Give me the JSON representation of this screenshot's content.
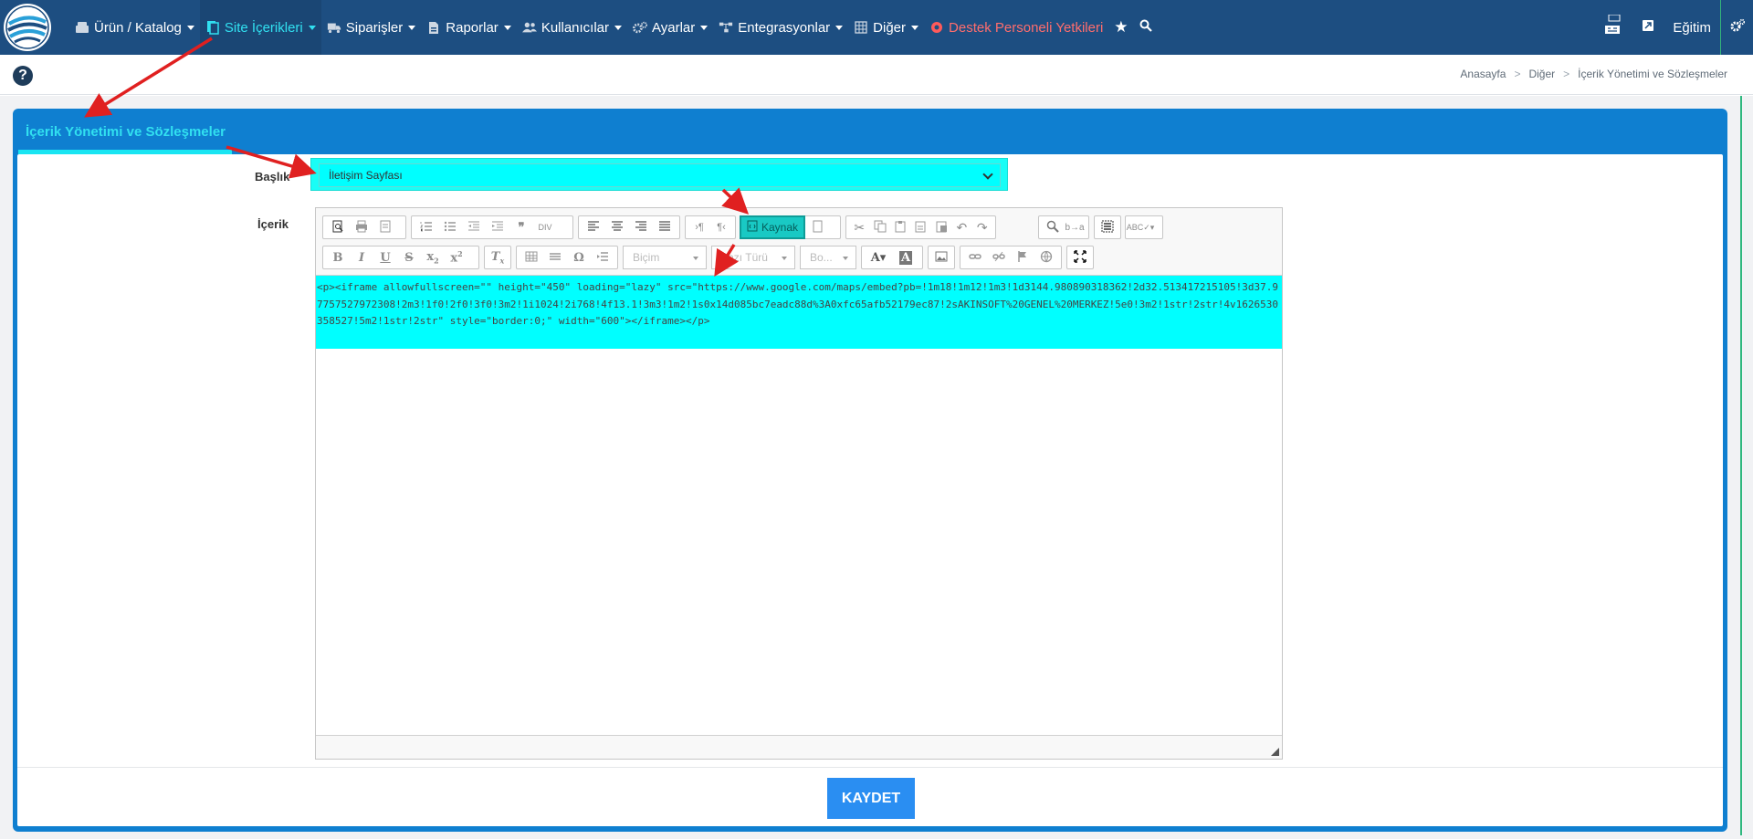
{
  "nav": {
    "items": [
      {
        "label": "Ürün / Katalog",
        "icon": "catalog-icon",
        "active": false
      },
      {
        "label": "Site İçerikleri",
        "icon": "content-icon",
        "active": true
      },
      {
        "label": "Siparişler",
        "icon": "truck-icon",
        "active": false
      },
      {
        "label": "Raporlar",
        "icon": "report-icon",
        "active": false
      },
      {
        "label": "Kullanıcılar",
        "icon": "users-icon",
        "active": false
      },
      {
        "label": "Ayarlar",
        "icon": "gears-icon",
        "active": false
      },
      {
        "label": "Entegrasyonlar",
        "icon": "sitemap-icon",
        "active": false
      },
      {
        "label": "Diğer",
        "icon": "grid-icon",
        "active": false
      }
    ],
    "support_label": "Destek Personeli Yetkileri",
    "training_label": "Eğitim"
  },
  "breadcrumb": [
    "Anasayfa",
    "Diğer",
    "İçerik Yönetimi ve Sözleşmeler"
  ],
  "panel": {
    "title": "İçerik Yönetimi ve Sözleşmeler"
  },
  "form": {
    "title_label": "Başlık",
    "title_value": "İletişim Sayfası",
    "content_label": "İçerik"
  },
  "editor": {
    "source_label": "Kaynak",
    "format_placeholder": "Biçim",
    "font_placeholder": "Yazı Türü",
    "size_placeholder": "Bo...",
    "source_code": "<p><iframe allowfullscreen=\"\" height=\"450\" loading=\"lazy\" src=\"https://www.google.com/maps/embed?pb=!1m18!1m12!1m3!1d3144.980890318362!2d32.513417215105!3d37.97757527972308!2m3!1f0!2f0!3f0!3m2!1i1024!2i768!4f13.1!3m3!1m2!1s0x14d085bc7eadc88d%3A0xfc65afb52179ec87!2sAKINSOFT%20GENEL%20MERKEZ!5e0!3m2!1str!2str!4v1626530358527!5m2!1str!2str\" style=\"border:0;\" width=\"600\"></iframe></p>"
  },
  "save_label": "KAYDET",
  "colors": {
    "navbar": "#1d4e81",
    "active_nav": "#31e0f0",
    "panel": "#0f7fd0",
    "highlight": "#00ffff",
    "save_button": "#2a8ef2",
    "annotation_arrow": "#e02020"
  }
}
